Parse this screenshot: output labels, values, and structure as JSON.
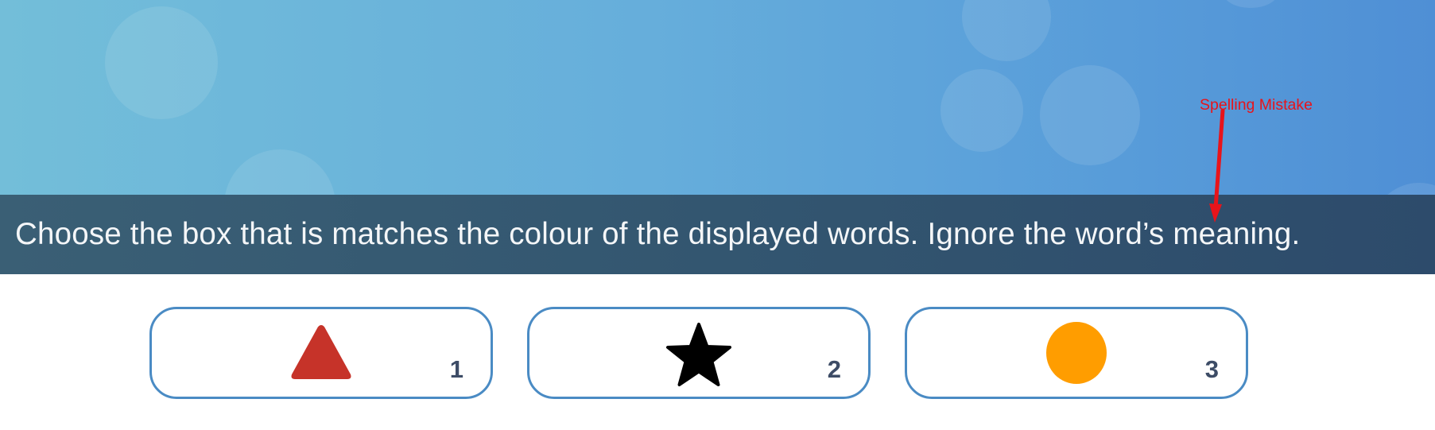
{
  "instruction": {
    "text": "Choose the box that is matches the colour of the displayed words. Ignore the word’s meaning."
  },
  "options": [
    {
      "number": "1",
      "shape": "triangle-icon",
      "color": "#c63329"
    },
    {
      "number": "2",
      "shape": "star-icon",
      "color": "#000000"
    },
    {
      "number": "3",
      "shape": "circle-icon",
      "color": "#ff9d00"
    }
  ],
  "annotation": {
    "label": "Spelling Mistake",
    "color": "#e8141b"
  },
  "colors": {
    "header_gradient_start": "#73bed9",
    "header_gradient_end": "#4f8fd5",
    "instruction_bar": "#335670",
    "box_border": "#4a8bc4",
    "number_text": "#3d4c66"
  }
}
